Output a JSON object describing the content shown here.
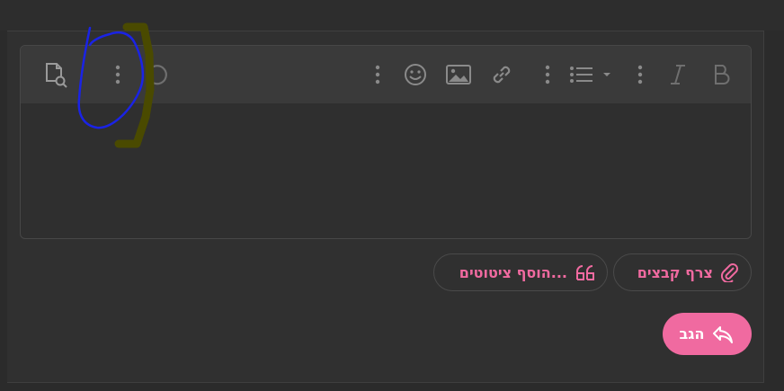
{
  "toolbar": {
    "icons": [
      "preview-icon",
      "more-icon",
      "undo-icon",
      "more-icon",
      "smiley-icon",
      "image-icon",
      "link-icon",
      "more-icon",
      "list-icon",
      "more-icon",
      "italic-icon",
      "bold-icon"
    ]
  },
  "actions": {
    "attach_label": "צרף קבצים",
    "quotes_label": "הוסף ציטוטים...",
    "reply_label": "הגב"
  },
  "colors": {
    "accent": "#f06aa0",
    "background": "#2b2b2b",
    "toolbar": "#3a3a3a",
    "icon": "#8a8a8a"
  }
}
